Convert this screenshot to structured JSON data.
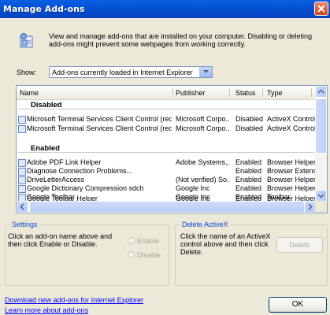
{
  "window": {
    "title": "Manage Add-ons"
  },
  "description": "View and manage add-ons that are installed on your computer. Disabling or deleting add-ons might prevent some webpages from working correctly.",
  "show": {
    "label": "Show:",
    "selected": "Add-ons currently loaded in Internet Explorer"
  },
  "columns": [
    "Name",
    "Publisher",
    "Status",
    "Type"
  ],
  "groups": {
    "disabled": "Disabled",
    "enabled": "Enabled"
  },
  "disabled_rows": [
    {
      "name": "Microsoft Terminal Services Client Control (redist)",
      "publisher": "Microsoft Corpo...",
      "status": "Disabled",
      "type": "ActiveX Control"
    },
    {
      "name": "Microsoft Terminal Services Client Control (redist)",
      "publisher": "Microsoft Corpo...",
      "status": "Disabled",
      "type": "ActiveX Control"
    }
  ],
  "enabled_rows": [
    {
      "name": "Adobe PDF Link Helper",
      "publisher": "Adobe Systems,...",
      "status": "Enabled",
      "type": "Browser Helper ("
    },
    {
      "name": "Diagnose Connection Problems...",
      "publisher": "",
      "status": "Enabled",
      "type": "Browser Extensio"
    },
    {
      "name": "DriveLetterAccess",
      "publisher": "(Not verified) So...",
      "status": "Enabled",
      "type": "Browser Helper ("
    },
    {
      "name": "Google Dictionary Compression sdch",
      "publisher": "Google Inc",
      "status": "Enabled",
      "type": "Browser Helper ("
    },
    {
      "name": "Google Toolbar",
      "publisher": "Google Inc",
      "status": "Enabled",
      "type": "Toolbar"
    },
    {
      "name": "Google Toolbar Helper",
      "publisher": "Google Inc",
      "status": "Enabled",
      "type": "Browser Helper ("
    }
  ],
  "settings": {
    "legend": "Settings",
    "text": "Click an add-on name above and then click Enable or Disable.",
    "enable": "Enable",
    "disable": "Disable"
  },
  "delete_activex": {
    "legend": "Delete ActiveX",
    "text": "Click the name of an ActiveX control above and then click Delete.",
    "button": "Delete"
  },
  "links": {
    "download": "Download new add-ons for Internet Explorer",
    "learn": "Learn more about add-ons"
  },
  "ok": "OK",
  "colors": {
    "title_bar": "#0553d4",
    "dialog_bg": "#ece9d8",
    "link": "#0000ff",
    "legend": "#0046d5"
  }
}
